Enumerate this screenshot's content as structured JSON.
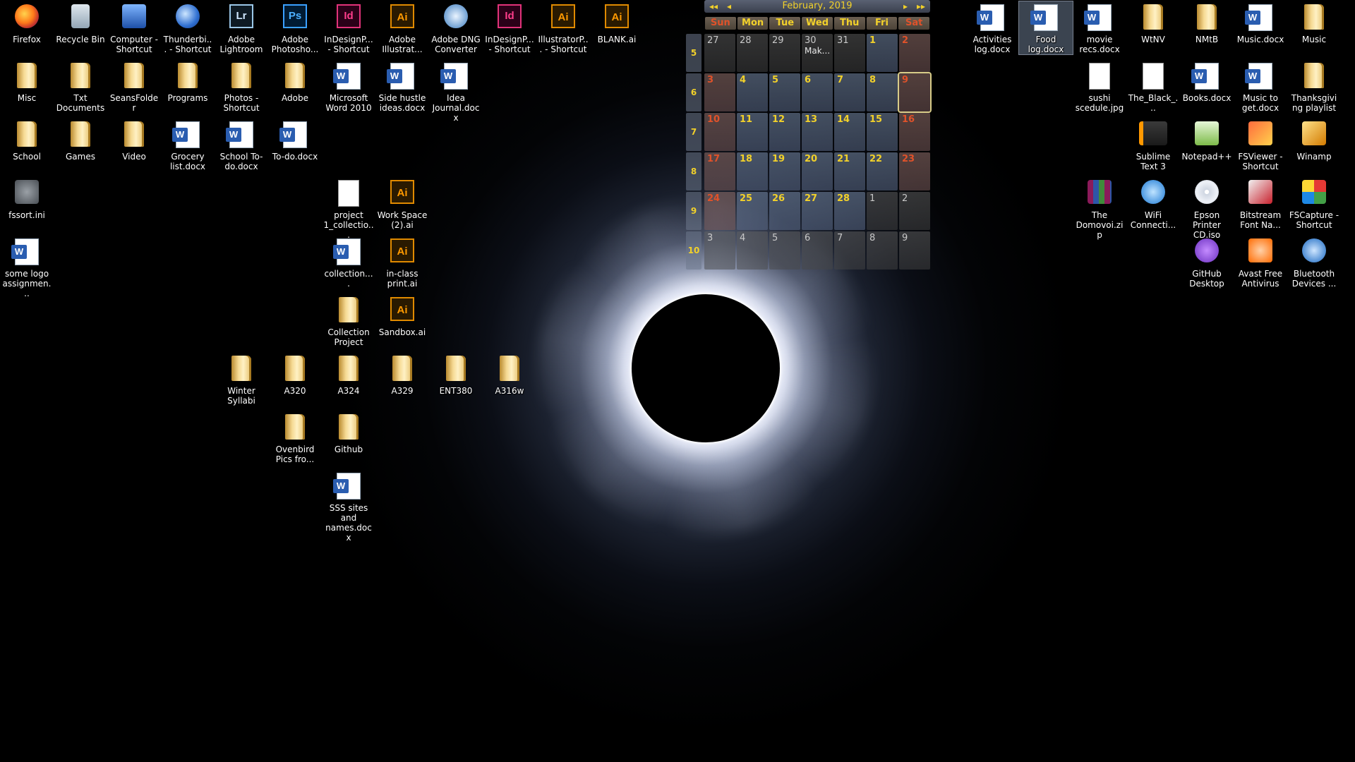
{
  "desktop": {
    "icons": [
      {
        "label": "Firefox",
        "type": "firefox"
      },
      {
        "label": "Recycle Bin",
        "type": "recycle"
      },
      {
        "label": "Computer - Shortcut",
        "type": "computer"
      },
      {
        "label": "Thunderbi... - Shortcut",
        "type": "thunderbird"
      },
      {
        "label": "Adobe Lightroom",
        "type": "lr"
      },
      {
        "label": "Adobe Photosho...",
        "type": "ps"
      },
      {
        "label": "InDesignP... - Shortcut",
        "type": "id"
      },
      {
        "label": "Adobe Illustrat...",
        "type": "ai"
      },
      {
        "label": "Adobe DNG Converter",
        "type": "dng"
      },
      {
        "label": "InDesignP... - Shortcut",
        "type": "id"
      },
      {
        "label": "IllustratorP... - Shortcut",
        "type": "ai"
      },
      {
        "label": "BLANK.ai",
        "type": "ai"
      },
      {
        "label": "Misc",
        "type": "folder"
      },
      {
        "label": "Txt Documents",
        "type": "folder"
      },
      {
        "label": "SeansFolder",
        "type": "folder"
      },
      {
        "label": "Programs",
        "type": "folder"
      },
      {
        "label": "Photos - Shortcut",
        "type": "folder"
      },
      {
        "label": "Adobe",
        "type": "folder"
      },
      {
        "label": "Microsoft Word 2010",
        "type": "word"
      },
      {
        "label": "Side hustle ideas.docx",
        "type": "docx"
      },
      {
        "label": "Idea Journal.docx",
        "type": "docx"
      },
      {
        "label": "School",
        "type": "folder"
      },
      {
        "label": "Games",
        "type": "folder"
      },
      {
        "label": "Video",
        "type": "folder"
      },
      {
        "label": "Grocery list.docx",
        "type": "docx"
      },
      {
        "label": "School To-do.docx",
        "type": "docx"
      },
      {
        "label": "To-do.docx",
        "type": "docx"
      },
      {
        "label": "fssort.ini",
        "type": "ini"
      },
      {
        "label": "project 1_collectio...",
        "type": "file"
      },
      {
        "label": "Work Space (2).ai",
        "type": "ai"
      },
      {
        "label": "some logo assignmen...",
        "type": "docx"
      },
      {
        "label": "collection....",
        "type": "docx"
      },
      {
        "label": "in-class print.ai",
        "type": "ai"
      },
      {
        "label": "Collection Project",
        "type": "folder"
      },
      {
        "label": "Sandbox.ai",
        "type": "ai"
      },
      {
        "label": "Winter Syllabi",
        "type": "folder"
      },
      {
        "label": "A320",
        "type": "folder"
      },
      {
        "label": "A324",
        "type": "folder"
      },
      {
        "label": "A329",
        "type": "folder"
      },
      {
        "label": "ENT380",
        "type": "folder"
      },
      {
        "label": "A316w",
        "type": "folder"
      },
      {
        "label": "Ovenbird Pics fro...",
        "type": "folder"
      },
      {
        "label": "Github",
        "type": "folder"
      },
      {
        "label": "SSS sites and names.docx",
        "type": "docx"
      },
      {
        "label": "Activities log.docx",
        "type": "docx"
      },
      {
        "label": "Food log.docx",
        "type": "docx"
      },
      {
        "label": "movie recs.docx",
        "type": "docx"
      },
      {
        "label": "WtNV",
        "type": "folder"
      },
      {
        "label": "NMtB",
        "type": "folder"
      },
      {
        "label": "Music.docx",
        "type": "docx"
      },
      {
        "label": "Music",
        "type": "folder"
      },
      {
        "label": "sushi scedule.jpg",
        "type": "file"
      },
      {
        "label": "The_Black_...",
        "type": "file"
      },
      {
        "label": "Books.docx",
        "type": "docx"
      },
      {
        "label": "Music to get.docx",
        "type": "docx"
      },
      {
        "label": "Thanksgiving playlist",
        "type": "folder"
      },
      {
        "label": "Sublime Text 3",
        "type": "sublime"
      },
      {
        "label": "Notepad++",
        "type": "notepad"
      },
      {
        "label": "FSViewer - Shortcut",
        "type": "fsviewer"
      },
      {
        "label": "Winamp",
        "type": "winamp"
      },
      {
        "label": "The Domovoi.zip",
        "type": "zip"
      },
      {
        "label": "WiFi Connecti...",
        "type": "wifi"
      },
      {
        "label": "Epson Printer CD.iso",
        "type": "iso"
      },
      {
        "label": "Bitstream Font Na...",
        "type": "bitstream"
      },
      {
        "label": "FSCapture - Shortcut",
        "type": "fscapture"
      },
      {
        "label": "GitHub Desktop",
        "type": "github"
      },
      {
        "label": "Avast Free Antivirus",
        "type": "avast"
      },
      {
        "label": "Bluetooth Devices ...",
        "type": "bluetooth"
      }
    ]
  },
  "calendar": {
    "title": "February, 2019",
    "nav": {
      "prev_year": "◂◂",
      "prev_month": "◂",
      "next_month": "▸",
      "next_year": "▸▸"
    },
    "weekdays": [
      "Sun",
      "Mon",
      "Tue",
      "Wed",
      "Thu",
      "Fri",
      "Sat"
    ],
    "weeks": [
      {
        "num": "5",
        "days": [
          {
            "d": "27",
            "other": true
          },
          {
            "d": "28",
            "other": true
          },
          {
            "d": "29",
            "other": true
          },
          {
            "d": "30",
            "other": true,
            "note": "Mak..."
          },
          {
            "d": "31",
            "other": true
          },
          {
            "d": "1"
          },
          {
            "d": "2"
          }
        ]
      },
      {
        "num": "6",
        "days": [
          {
            "d": "3"
          },
          {
            "d": "4"
          },
          {
            "d": "5"
          },
          {
            "d": "6"
          },
          {
            "d": "7"
          },
          {
            "d": "8"
          },
          {
            "d": "9",
            "today": true
          }
        ]
      },
      {
        "num": "7",
        "days": [
          {
            "d": "10"
          },
          {
            "d": "11"
          },
          {
            "d": "12"
          },
          {
            "d": "13"
          },
          {
            "d": "14"
          },
          {
            "d": "15"
          },
          {
            "d": "16"
          }
        ]
      },
      {
        "num": "8",
        "days": [
          {
            "d": "17"
          },
          {
            "d": "18"
          },
          {
            "d": "19"
          },
          {
            "d": "20"
          },
          {
            "d": "21"
          },
          {
            "d": "22"
          },
          {
            "d": "23"
          }
        ]
      },
      {
        "num": "9",
        "days": [
          {
            "d": "24"
          },
          {
            "d": "25"
          },
          {
            "d": "26"
          },
          {
            "d": "27"
          },
          {
            "d": "28"
          },
          {
            "d": "1",
            "other": true
          },
          {
            "d": "2",
            "other": true
          }
        ]
      },
      {
        "num": "10",
        "days": [
          {
            "d": "3",
            "other": true
          },
          {
            "d": "4",
            "other": true
          },
          {
            "d": "5",
            "other": true
          },
          {
            "d": "6",
            "other": true
          },
          {
            "d": "7",
            "other": true
          },
          {
            "d": "8",
            "other": true
          },
          {
            "d": "9",
            "other": true
          }
        ]
      }
    ]
  },
  "colors": {
    "calendar_accent": "#f2d12a",
    "calendar_weekend": "#e0522a"
  }
}
